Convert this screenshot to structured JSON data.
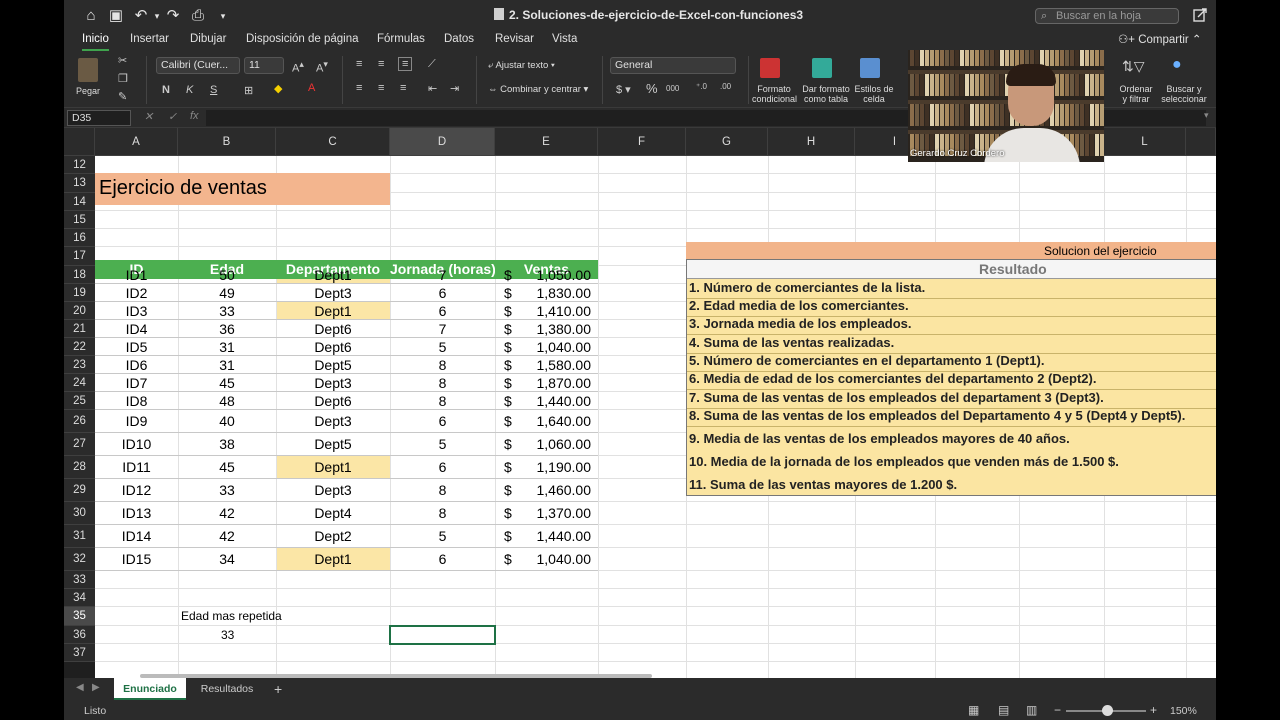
{
  "window": {
    "title": "2. Soluciones-de-ejercicio-de-Excel-con-funciones3",
    "search_placeholder": "Buscar en la hoja"
  },
  "ribbon_tabs": [
    "Inicio",
    "Insertar",
    "Dibujar",
    "Disposición de página",
    "Fórmulas",
    "Datos",
    "Revisar",
    "Vista"
  ],
  "share_label": "Compartir",
  "ribbon": {
    "paste_label": "Pegar",
    "font_name": "Calibri (Cuer...",
    "font_size": "11",
    "wrap_text": "Ajustar texto",
    "merge_center": "Combinar y centrar",
    "number_format": "General",
    "cond_format": "Formato condicional",
    "format_table": "Dar formato como tabla",
    "cell_styles": "Estilos de celda",
    "sort_filter": "Ordenar y filtrar",
    "find_select": "Buscar y seleccionar"
  },
  "formula_bar": {
    "name_box": "D35",
    "fx": "fx",
    "value": ""
  },
  "columns": [
    "A",
    "B",
    "C",
    "D",
    "E",
    "F",
    "G",
    "H",
    "I",
    "L"
  ],
  "rows": [
    "12",
    "13",
    "14",
    "15",
    "16",
    "17",
    "18",
    "19",
    "20",
    "21",
    "22",
    "23",
    "24",
    "25",
    "26",
    "27",
    "28",
    "29",
    "30",
    "31",
    "32",
    "33",
    "34",
    "35",
    "36",
    "37"
  ],
  "sheet": {
    "title": "Ejercicio de ventas",
    "headers": [
      "ID",
      "Edad",
      "Departamento",
      "Jornada (horas)",
      "Ventas"
    ],
    "data": [
      {
        "id": "ID1",
        "edad": "50",
        "dept": "Dept1",
        "jornada": "7",
        "ventas": "1,050.00"
      },
      {
        "id": "ID2",
        "edad": "49",
        "dept": "Dept3",
        "jornada": "6",
        "ventas": "1,830.00"
      },
      {
        "id": "ID3",
        "edad": "33",
        "dept": "Dept1",
        "jornada": "6",
        "ventas": "1,410.00"
      },
      {
        "id": "ID4",
        "edad": "36",
        "dept": "Dept6",
        "jornada": "7",
        "ventas": "1,380.00"
      },
      {
        "id": "ID5",
        "edad": "31",
        "dept": "Dept6",
        "jornada": "5",
        "ventas": "1,040.00"
      },
      {
        "id": "ID6",
        "edad": "31",
        "dept": "Dept5",
        "jornada": "8",
        "ventas": "1,580.00"
      },
      {
        "id": "ID7",
        "edad": "45",
        "dept": "Dept3",
        "jornada": "8",
        "ventas": "1,870.00"
      },
      {
        "id": "ID8",
        "edad": "48",
        "dept": "Dept6",
        "jornada": "8",
        "ventas": "1,440.00"
      },
      {
        "id": "ID9",
        "edad": "40",
        "dept": "Dept3",
        "jornada": "6",
        "ventas": "1,640.00"
      },
      {
        "id": "ID10",
        "edad": "38",
        "dept": "Dept5",
        "jornada": "5",
        "ventas": "1,060.00"
      },
      {
        "id": "ID11",
        "edad": "45",
        "dept": "Dept1",
        "jornada": "6",
        "ventas": "1,190.00"
      },
      {
        "id": "ID12",
        "edad": "33",
        "dept": "Dept3",
        "jornada": "8",
        "ventas": "1,460.00"
      },
      {
        "id": "ID13",
        "edad": "42",
        "dept": "Dept4",
        "jornada": "8",
        "ventas": "1,370.00"
      },
      {
        "id": "ID14",
        "edad": "42",
        "dept": "Dept2",
        "jornada": "5",
        "ventas": "1,440.00"
      },
      {
        "id": "ID15",
        "edad": "34",
        "dept": "Dept1",
        "jornada": "6",
        "ventas": "1,040.00"
      }
    ],
    "currency_symbol": "$",
    "extra_label": "Edad mas repetida",
    "extra_value": "33"
  },
  "solution": {
    "header": "Solucion del ejercicio",
    "subheader": "Resultado",
    "items": [
      "1. Número de comerciantes de la lista.",
      "2. Edad media de los comerciantes.",
      "3. Jornada media de los empleados.",
      "4. Suma de las ventas realizadas.",
      "5. Número de comerciantes en el departamento 1 (Dept1).",
      "6. Media de edad de los comerciantes del departamento 2 (Dept2).",
      "7. Suma de las ventas de los empleados del departament 3 (Dept3).",
      "8. Suma de las ventas de los empleados del Departamento 4 y 5 (Dept4 y Dept5).",
      "9. Media de las ventas de los empleados mayores de 40 años.",
      "10. Media de la jornada de los empleados que venden más de 1.500 $.",
      "11. Suma de las ventas mayores de 1.200 $."
    ]
  },
  "video": {
    "participant": "Gerardo Cruz Cordero"
  },
  "sheet_tabs": [
    "Enunciado",
    "Resultados"
  ],
  "status": {
    "text": "Listo",
    "zoom": "150%"
  },
  "colors": {
    "header_green": "#4caf50",
    "highlight_yellow": "#fbe6a6",
    "title_orange": "#f3b58e",
    "accent": "#1e7145"
  }
}
